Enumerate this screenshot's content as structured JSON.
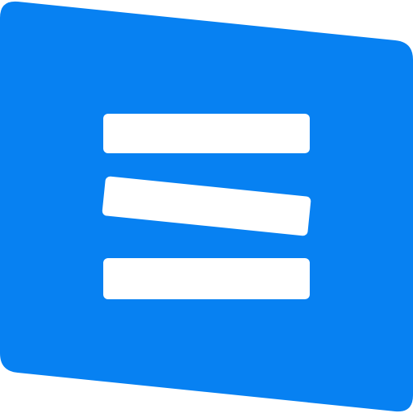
{
  "logo": {
    "icon": "menu-lines-logo",
    "colors": {
      "background": "#0781F2",
      "bars": "#FFFFFF"
    }
  }
}
